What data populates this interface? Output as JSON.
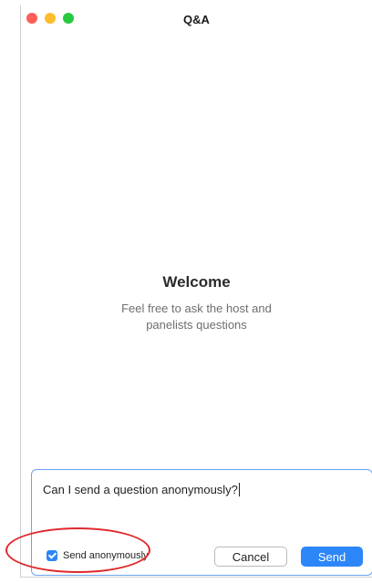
{
  "window": {
    "title": "Q&A"
  },
  "welcome": {
    "title": "Welcome",
    "subtitle": "Feel free to ask the host and panelists questions"
  },
  "composer": {
    "value": "Can I send a question anonymously?",
    "anonymous_label": "Send anonymously",
    "anonymous_checked": true,
    "cancel_label": "Cancel",
    "send_label": "Send"
  },
  "colors": {
    "accent": "#2d86f7",
    "highlight": "#e0282c"
  },
  "icons": {
    "close": "close-window-icon",
    "minimize": "minimize-window-icon",
    "maximize": "maximize-window-icon",
    "checkbox": "checkmark-icon"
  }
}
